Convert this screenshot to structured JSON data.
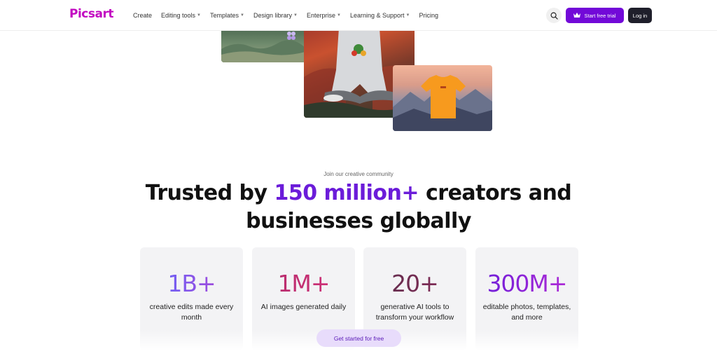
{
  "colors": {
    "brand": "#c209c1",
    "accent": "#6b1cd9",
    "trial_button": "#7209d8",
    "login_button": "#1f1f2b",
    "cta_bg": "#e8dcfb",
    "cta_text": "#5b1bb8"
  },
  "nav": {
    "logo": "Picsart",
    "links": [
      {
        "label": "Create",
        "dropdown": false
      },
      {
        "label": "Editing tools",
        "dropdown": true
      },
      {
        "label": "Templates",
        "dropdown": true
      },
      {
        "label": "Design library",
        "dropdown": true
      },
      {
        "label": "Enterprise",
        "dropdown": true
      },
      {
        "label": "Learning & Support",
        "dropdown": true
      },
      {
        "label": "Pricing",
        "dropdown": false
      }
    ],
    "search_icon": "search-icon",
    "trial_label": "Start free trial",
    "trial_icon": "crown-icon",
    "login_label": "Log in"
  },
  "hero": {
    "eyebrow": "Join our creative community",
    "headline_before": "Trusted by ",
    "headline_accent": "150 million+",
    "headline_after_line1": " creators and",
    "headline_line2": "businesses globally"
  },
  "stats": [
    {
      "value": "1B+",
      "label": "creative edits made every month"
    },
    {
      "value": "1M+",
      "label": "AI images generated daily"
    },
    {
      "value": "20+",
      "label": "generative AI tools to transform your workflow"
    },
    {
      "value": "300M+",
      "label": "editable photos, templates, and more"
    }
  ],
  "cta": {
    "label": "Get started for free"
  }
}
